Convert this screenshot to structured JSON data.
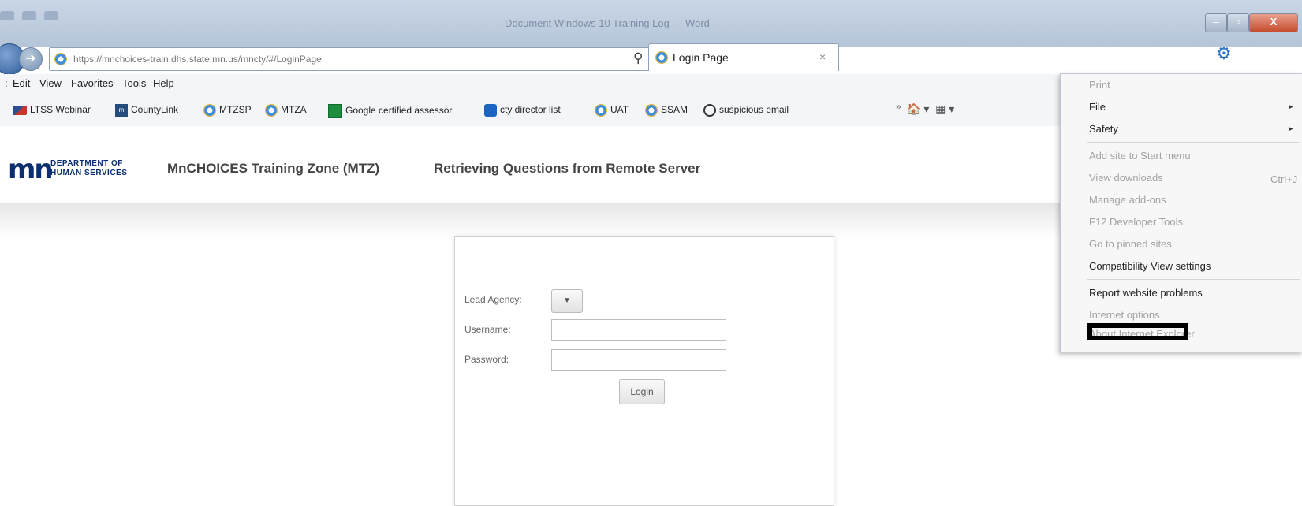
{
  "window": {
    "title": "Document Windows 10 Training Log — Word",
    "close_label": "X"
  },
  "nav": {
    "url": "https://mnchoices-train.dhs.state.mn.us/mncty/#/LoginPage",
    "tab_title": "Login Page",
    "tab_close": "×"
  },
  "menubar": {
    "items": [
      "Edit",
      "View",
      "Favorites",
      "Tools",
      "Help"
    ]
  },
  "favorites": {
    "items": [
      "LTSS Webinar",
      "CountyLink",
      "MTZSP",
      "MTZA",
      "Google certified assessor",
      "cty director list",
      "UAT",
      "SSAM",
      "suspicious email"
    ],
    "chevron": "»"
  },
  "header": {
    "logo_mark": "mn",
    "dept_line1": "DEPARTMENT OF",
    "dept_line2": "HUMAN SERVICES",
    "app_title": "MnCHOICES Training Zone (MTZ)",
    "status": "Retrieving Questions from Remote Server"
  },
  "login": {
    "agency_label": "Lead Agency:",
    "username_label": "Username:",
    "password_label": "Password:",
    "username_value": "",
    "password_value": "",
    "button_label": "Login"
  },
  "tools_menu": {
    "print": "Print",
    "file": "File",
    "safety": "Safety",
    "add_site": "Add site to Start menu",
    "view_downloads": "View downloads",
    "view_downloads_shortcut": "Ctrl+J",
    "manage_addons": "Manage add-ons",
    "f12": "F12 Developer Tools",
    "pinned": "Go to pinned sites",
    "compat": "Compatibility View settings",
    "report": "Report website problems",
    "internet_options": "Internet options",
    "about": "About Internet Explorer"
  },
  "icons": {
    "back": "back-arrow-icon",
    "forward": "forward-arrow-icon",
    "search": "search-icon",
    "refresh": "refresh-icon",
    "home": "home-icon",
    "favorites": "star-icon",
    "tools": "gear-icon"
  },
  "colors": {
    "ie_blue": "#2a73c6",
    "dhs_navy": "#0b2f6e",
    "close_red": "#c64c2e"
  }
}
